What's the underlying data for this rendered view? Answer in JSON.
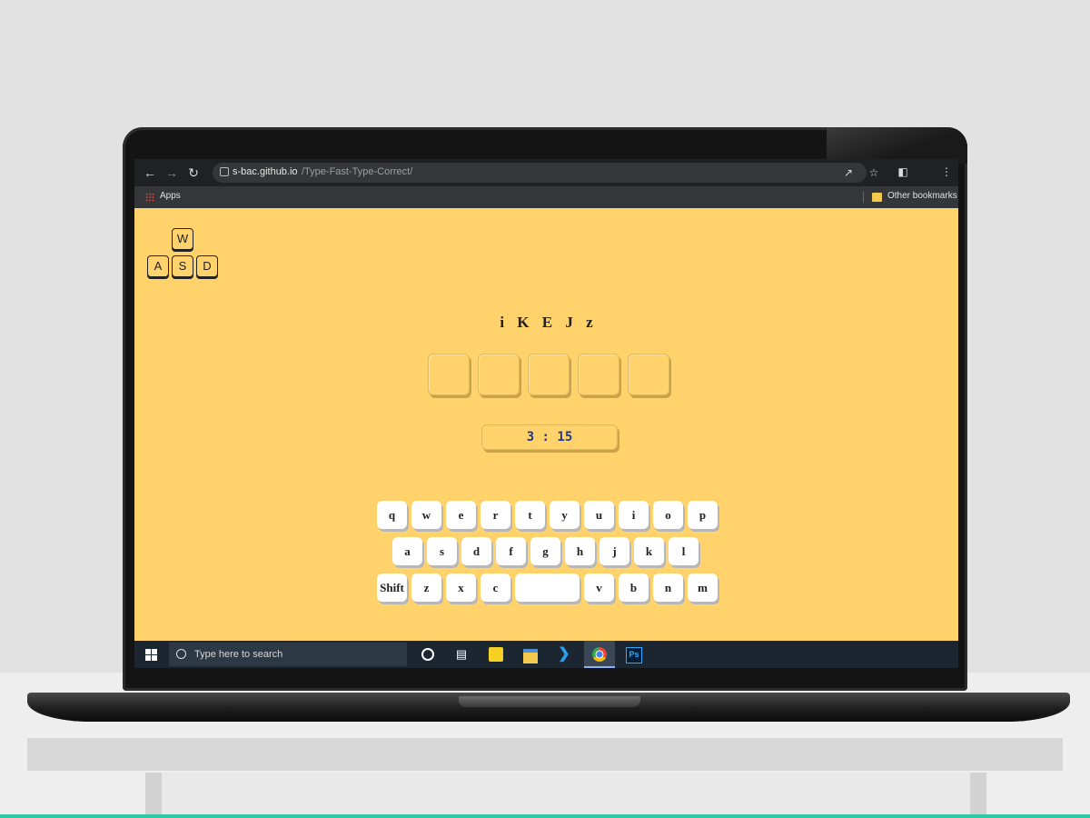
{
  "browser": {
    "url_host": "s-bac.github.io",
    "url_path": "/Type-Fast-Type-Correct/",
    "bookmarks": {
      "apps_label": "Apps",
      "other_label": "Other bookmarks"
    }
  },
  "logo": {
    "keys": [
      "W",
      "A",
      "S",
      "D"
    ]
  },
  "game": {
    "target_letters": [
      "i",
      "K",
      "E",
      "J",
      "z"
    ],
    "slot_count": 5,
    "timer": "3 : 15"
  },
  "keyboard": {
    "row1": [
      "q",
      "w",
      "e",
      "r",
      "t",
      "y",
      "u",
      "i",
      "o",
      "p"
    ],
    "row2": [
      "a",
      "s",
      "d",
      "f",
      "g",
      "h",
      "j",
      "k",
      "l"
    ],
    "row3": [
      "Shift",
      "z",
      "x",
      "c",
      "",
      "v",
      "b",
      "n",
      "m"
    ]
  },
  "taskbar": {
    "search_placeholder": "Type here to search",
    "apps": [
      "cortana-icon",
      "task-view-icon",
      "sticky-notes-icon",
      "file-explorer-icon",
      "vscode-icon",
      "chrome-icon",
      "photoshop-icon"
    ],
    "ps_label": "Ps"
  },
  "colors": {
    "page_bg": "#ffd26b",
    "timer_text": "#1e3a8a",
    "taskbar": "#1b2631"
  }
}
